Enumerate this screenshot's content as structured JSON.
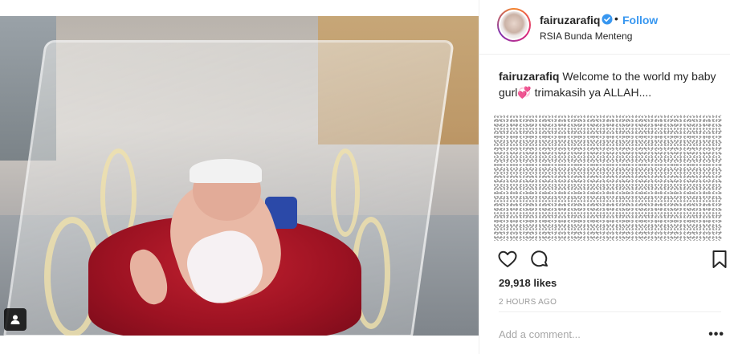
{
  "post": {
    "username": "fairuzarafiq",
    "verified": true,
    "follow_label": "Follow",
    "location": "RSIA Bunda Menteng",
    "caption_user": "fairuzarafiq",
    "caption_text": "Welcome to the world my baby gurl💞 trimakasih ya ALLAH....",
    "likes": "29,918 likes",
    "time_ago": "2 HOURS AGO",
    "comment_placeholder": "Add a comment...",
    "more_label": "•••"
  },
  "icons": {
    "like": "heart-icon",
    "comment": "comment-icon",
    "save": "bookmark-icon",
    "verified": "verified-badge-icon",
    "photo_tag": "user-tag-icon"
  },
  "colors": {
    "follow": "#3897f0",
    "verified": "#3897f0",
    "text": "#262626",
    "muted": "#999999"
  }
}
